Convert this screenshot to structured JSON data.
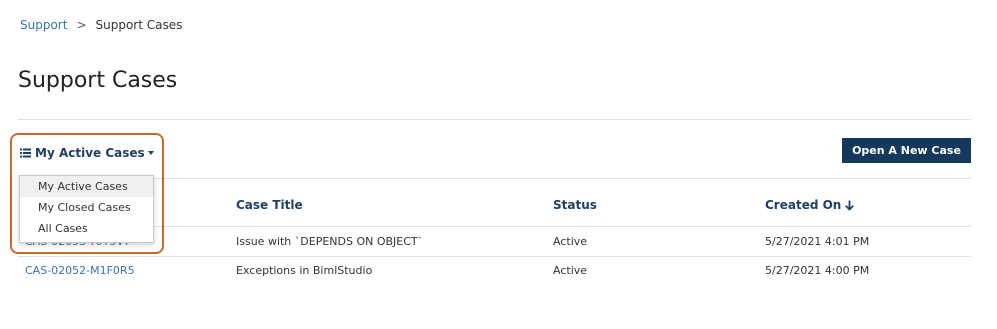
{
  "breadcrumb": {
    "home": "Support",
    "separator": ">",
    "current": "Support Cases"
  },
  "page": {
    "title": "Support Cases"
  },
  "view_toggle": {
    "label": "My Active Cases",
    "icon": "list-icon"
  },
  "dropdown": {
    "items": [
      {
        "label": "My Active Cases"
      },
      {
        "label": "My Closed Cases"
      },
      {
        "label": "All Cases"
      }
    ]
  },
  "toolbar": {
    "open_case_label": "Open A New Case"
  },
  "table": {
    "columns": [
      "Case Title",
      "Status",
      "Created On"
    ],
    "sort_icon": "arrow-down-icon",
    "rows": [
      {
        "case_number": "CAS-02053-Y0T5V7",
        "title": "Issue with `DEPENDS ON OBJECT`",
        "status": "Active",
        "created_on": "5/27/2021 4:01 PM"
      },
      {
        "case_number": "CAS-02052-M1F0R5",
        "title": "Exceptions in BimlStudio",
        "status": "Active",
        "created_on": "5/27/2021 4:00 PM"
      }
    ]
  },
  "colors": {
    "accent": "#14395d",
    "link": "#3a73b3",
    "highlight": "#c86a2c"
  }
}
